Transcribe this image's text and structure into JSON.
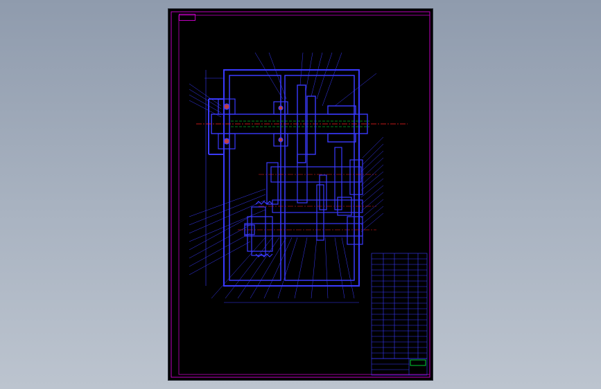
{
  "drawing": {
    "code_tab": "",
    "technical_requirements_title": "",
    "technical_requirements": [],
    "title_block": {
      "title": "",
      "scale": "",
      "sheet": ""
    }
  },
  "colors": {
    "background": "#000000",
    "frame": "#c000c0",
    "outline": "#3a3aff",
    "centerline": "#ff2020",
    "hidden_line": "#00ff40",
    "text": "#2c3cff",
    "title_text": "#00ff40"
  }
}
